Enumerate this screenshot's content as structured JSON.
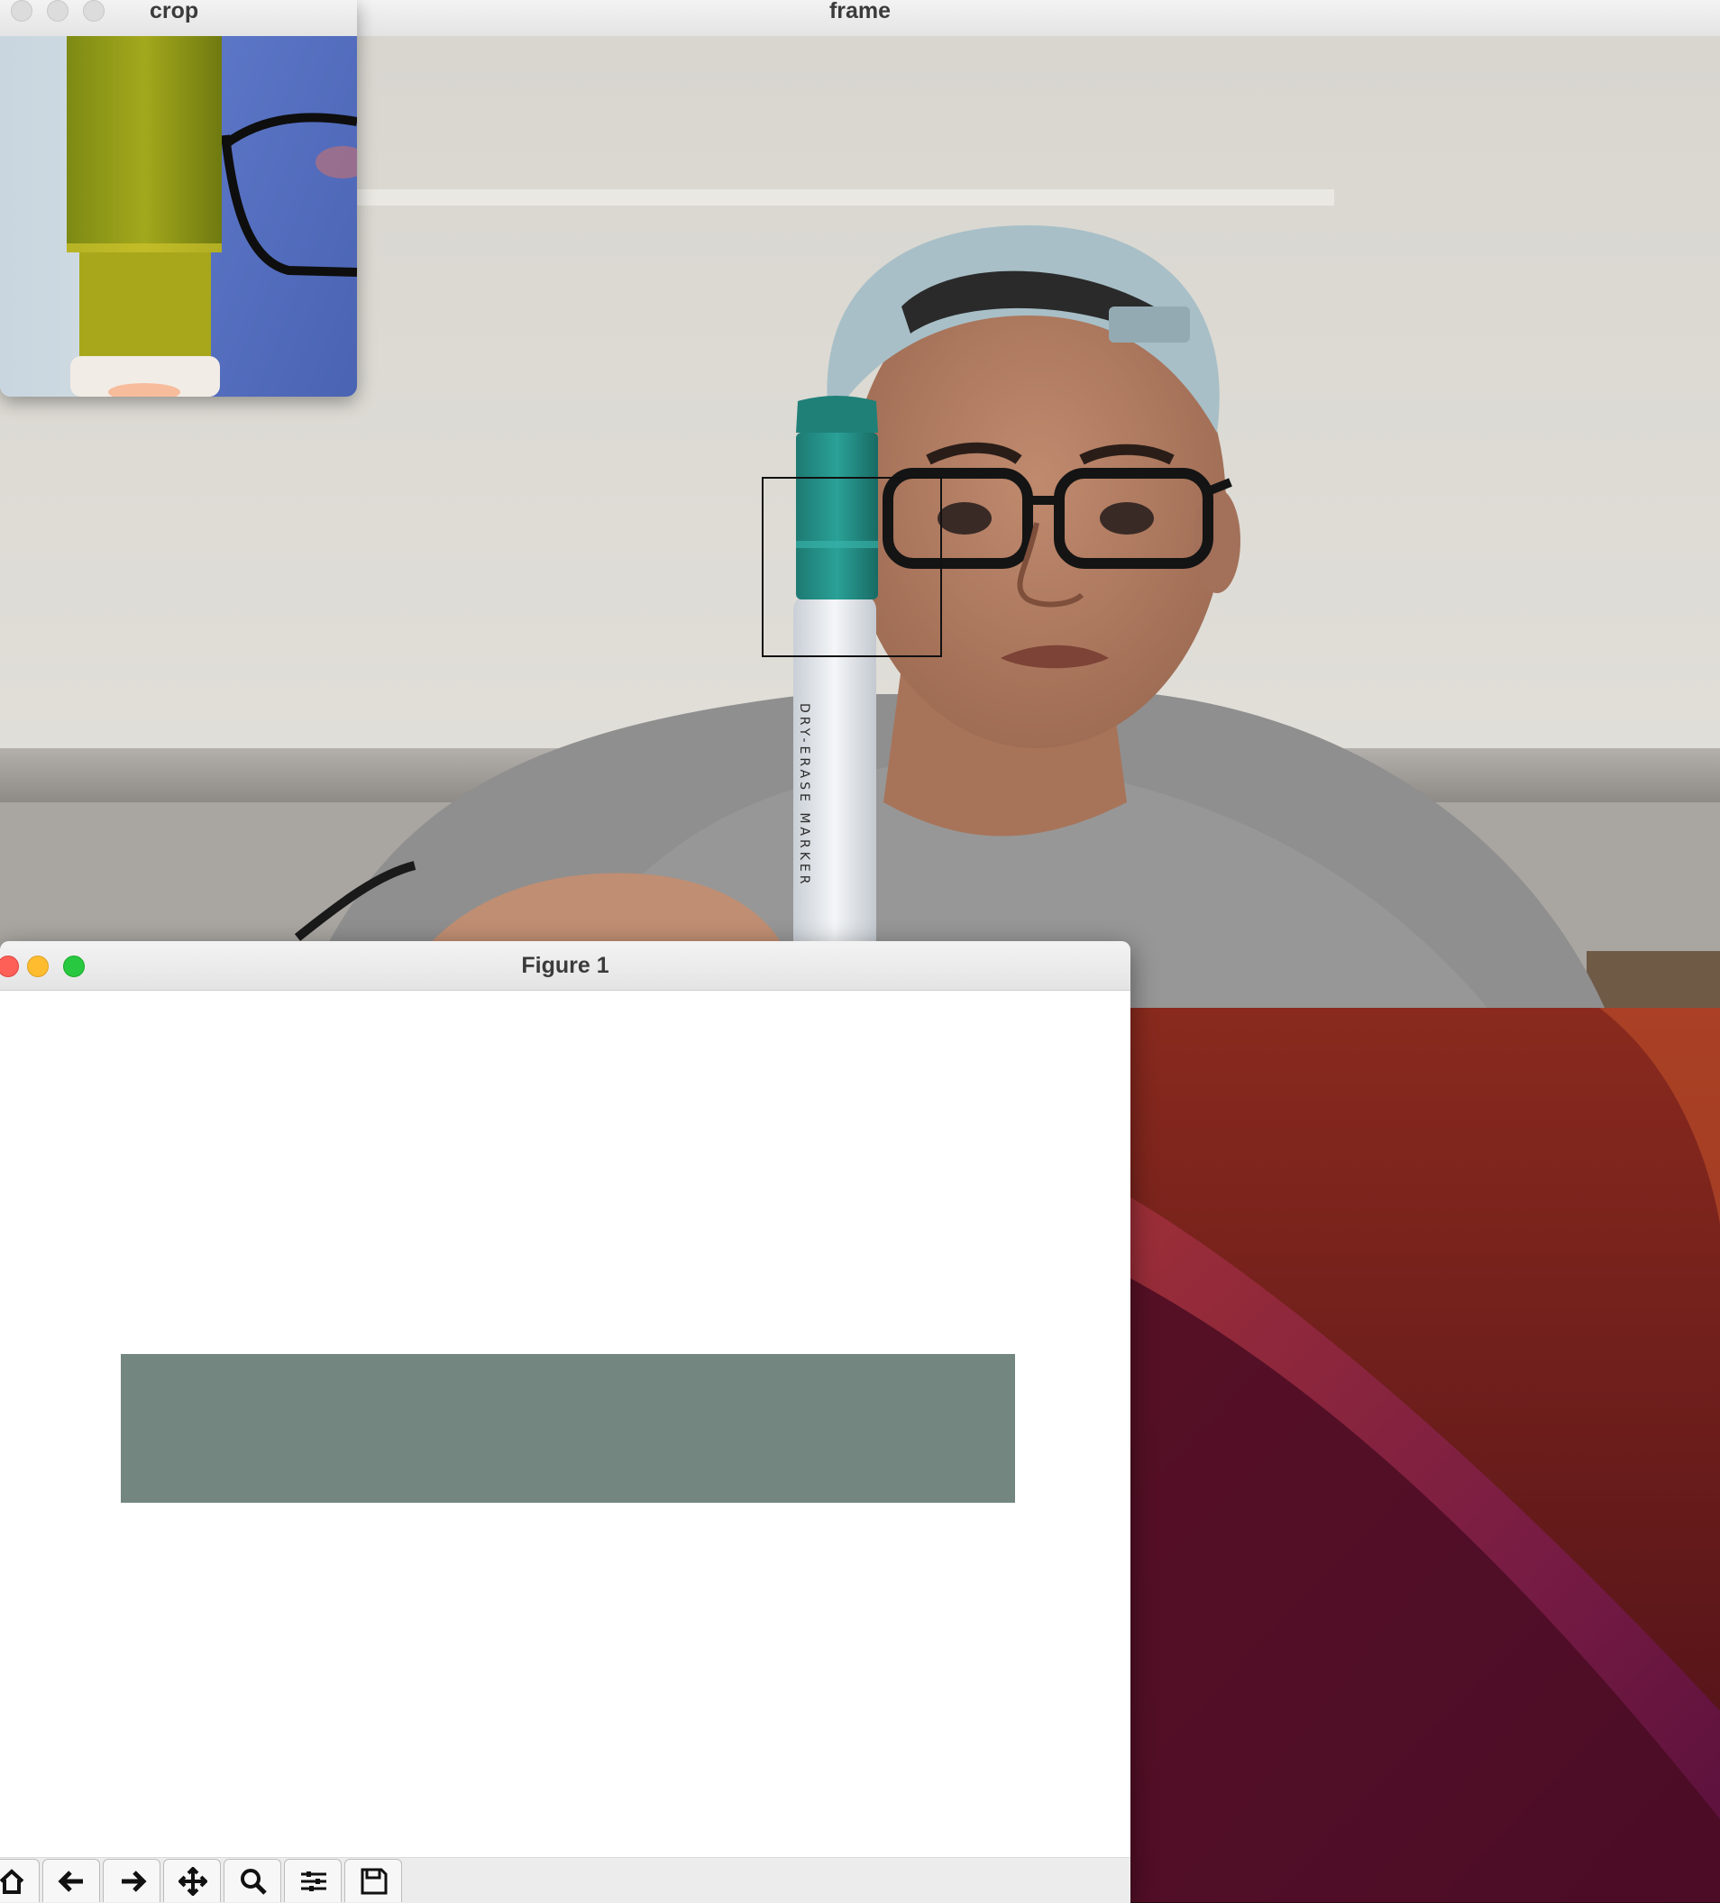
{
  "windows": {
    "frame": {
      "title": "frame"
    },
    "crop": {
      "title": "crop"
    },
    "figure": {
      "title": "Figure 1"
    }
  },
  "scene": {
    "marker_label": "DRY-ERASE MARKER"
  },
  "figure": {
    "swatch_color": "#738780"
  },
  "toolbar": {
    "buttons": [
      {
        "icon": "home-icon"
      },
      {
        "icon": "back-arrow-icon"
      },
      {
        "icon": "forward-arrow-icon"
      },
      {
        "icon": "pan-icon"
      },
      {
        "icon": "zoom-icon"
      },
      {
        "icon": "configure-subplots-icon"
      },
      {
        "icon": "save-icon"
      }
    ]
  },
  "colors": {
    "close": "#fe5f57",
    "minimize": "#febc2e",
    "maximize": "#28c840",
    "inactive_light": "#dcdcdc"
  }
}
